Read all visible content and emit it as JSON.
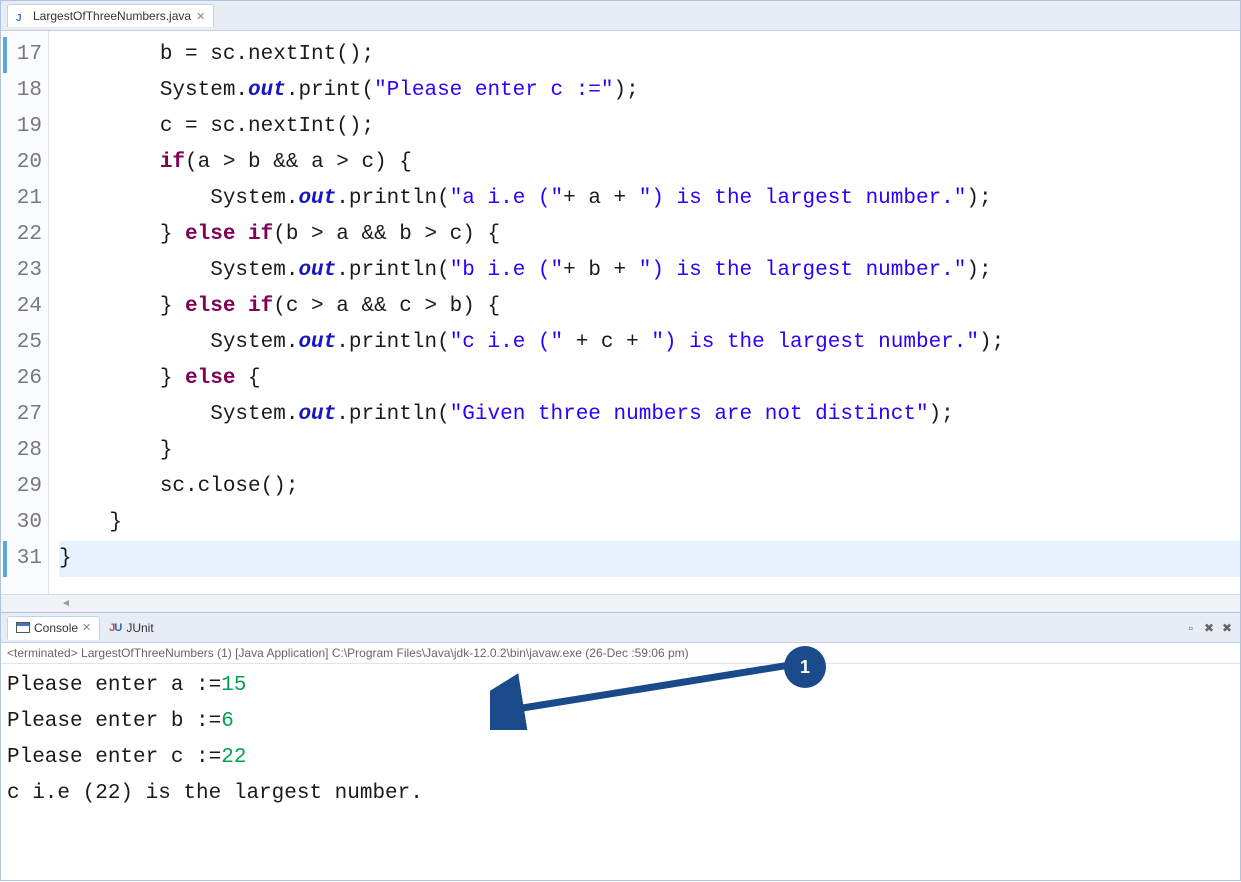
{
  "editor": {
    "tab": {
      "filename": "LargestOfThreeNumbers.java"
    },
    "lines": [
      {
        "n": "17",
        "i2": "        b = sc.nextInt();"
      },
      {
        "n": "18",
        "i2": "        System.",
        "fld": "out",
        "aft": ".print(",
        "s": "\"Please enter c :=\"",
        "end": ");"
      },
      {
        "n": "19",
        "i2": "        c = sc.nextInt();"
      },
      {
        "n": "20",
        "i2": "        ",
        "kw": "if",
        "aft2": "(a > b && a > c) {"
      },
      {
        "n": "21",
        "i2": "            System.",
        "fld": "out",
        "aft": ".println(",
        "s": "\"a i.e (\"",
        "mid": "+ a + ",
        "s2": "\") is the largest number.\"",
        "end": ");"
      },
      {
        "n": "22",
        "i2": "        } ",
        "kw": "else if",
        "aft2": "(b > a && b > c) {"
      },
      {
        "n": "23",
        "i2": "            System.",
        "fld": "out",
        "aft": ".println(",
        "s": "\"b i.e (\"",
        "mid": "+ b + ",
        "s2": "\") is the largest number.\"",
        "end": ");"
      },
      {
        "n": "24",
        "i2": "        } ",
        "kw": "else if",
        "aft2": "(c > a && c > b) {"
      },
      {
        "n": "25",
        "i2": "            System.",
        "fld": "out",
        "aft": ".println(",
        "s": "\"c i.e (\"",
        "mid": " + c + ",
        "s2": "\") is the largest number.\"",
        "end": ");"
      },
      {
        "n": "26",
        "i2": "        } ",
        "kw": "else",
        "aft2": " {"
      },
      {
        "n": "27",
        "i2": "            System.",
        "fld": "out",
        "aft": ".println(",
        "s": "\"Given three numbers are not distinct\"",
        "end": ");"
      },
      {
        "n": "28",
        "i2": "        }"
      },
      {
        "n": "29",
        "i2": "        sc.close();"
      },
      {
        "n": "30",
        "i2": "    }"
      },
      {
        "n": "31",
        "i2": "}"
      }
    ]
  },
  "bottom": {
    "tabs": {
      "console": "Console",
      "junit": "JUnit"
    },
    "status": "<terminated> LargestOfThreeNumbers (1) [Java Application] C:\\Program Files\\Java\\jdk-12.0.2\\bin\\javaw.exe (26-Dec          :59:06 pm)"
  },
  "console": {
    "lines": [
      {
        "prompt": "Please enter a :=",
        "input": "15"
      },
      {
        "prompt": "Please enter b :=",
        "input": "6"
      },
      {
        "prompt": "Please enter c :=",
        "input": "22"
      },
      {
        "prompt": "c i.e (22) is the largest number.",
        "input": ""
      }
    ]
  },
  "annotation": {
    "marker": "1"
  }
}
